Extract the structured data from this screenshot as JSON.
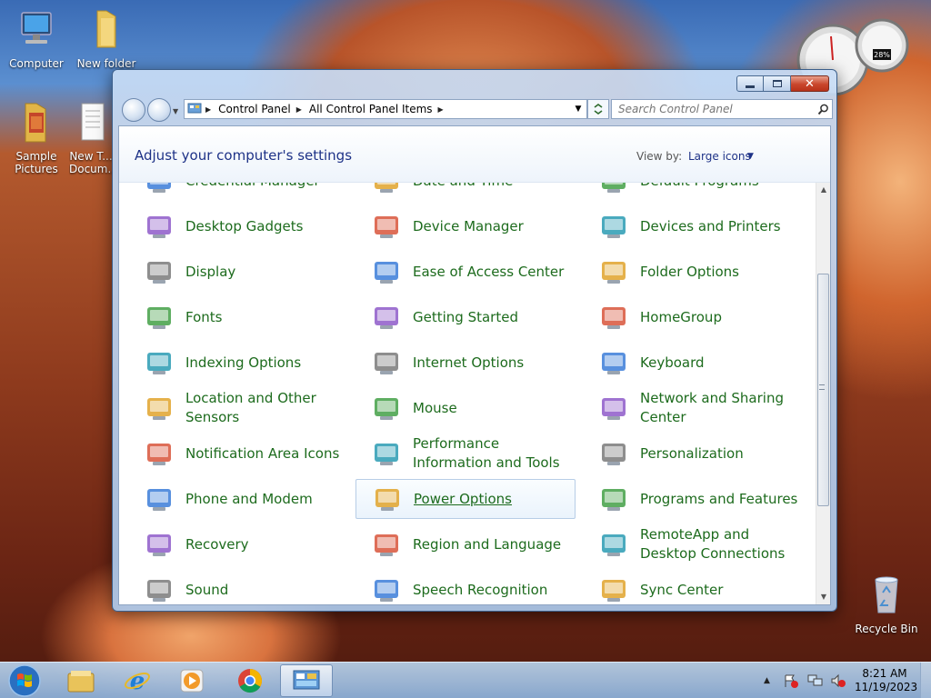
{
  "desktop": {
    "icons": [
      {
        "label": "Computer"
      },
      {
        "label": "New folder"
      },
      {
        "label": "Sample Pictures"
      },
      {
        "label": "New T... Docum..."
      },
      {
        "label": "Recycle Bin"
      }
    ],
    "gadget_cpu": "28%"
  },
  "window": {
    "address": {
      "crumbs": [
        "Control Panel",
        "All Control Panel Items"
      ]
    },
    "search": {
      "placeholder": "Search Control Panel"
    },
    "heading": "Adjust your computer's settings",
    "view_by": {
      "label": "View by:",
      "value": "Large icons"
    },
    "items": [
      {
        "label": "Credential Manager",
        "icon": "credential-manager-icon"
      },
      {
        "label": "Date and Time",
        "icon": "date-time-icon"
      },
      {
        "label": "Default Programs",
        "icon": "default-programs-icon"
      },
      {
        "label": "Desktop Gadgets",
        "icon": "desktop-gadgets-icon"
      },
      {
        "label": "Device Manager",
        "icon": "device-manager-icon"
      },
      {
        "label": "Devices and Printers",
        "icon": "printer-icon"
      },
      {
        "label": "Display",
        "icon": "display-icon"
      },
      {
        "label": "Ease of Access Center",
        "icon": "ease-of-access-icon"
      },
      {
        "label": "Folder Options",
        "icon": "folder-options-icon"
      },
      {
        "label": "Fonts",
        "icon": "fonts-icon"
      },
      {
        "label": "Getting Started",
        "icon": "getting-started-icon"
      },
      {
        "label": "HomeGroup",
        "icon": "homegroup-icon"
      },
      {
        "label": "Indexing Options",
        "icon": "indexing-icon"
      },
      {
        "label": "Internet Options",
        "icon": "internet-options-icon"
      },
      {
        "label": "Keyboard",
        "icon": "keyboard-icon"
      },
      {
        "label": "Location and Other Sensors",
        "icon": "location-sensors-icon"
      },
      {
        "label": "Mouse",
        "icon": "mouse-icon"
      },
      {
        "label": "Network and Sharing Center",
        "icon": "network-icon"
      },
      {
        "label": "Notification Area Icons",
        "icon": "notification-icon"
      },
      {
        "label": "Performance Information and Tools",
        "icon": "performance-icon"
      },
      {
        "label": "Personalization",
        "icon": "personalization-icon"
      },
      {
        "label": "Phone and Modem",
        "icon": "phone-icon"
      },
      {
        "label": "Power Options",
        "icon": "power-options-icon"
      },
      {
        "label": "Programs and Features",
        "icon": "programs-icon"
      },
      {
        "label": "Recovery",
        "icon": "recovery-icon"
      },
      {
        "label": "Region and Language",
        "icon": "region-icon"
      },
      {
        "label": "RemoteApp and Desktop Connections",
        "icon": "remoteapp-icon"
      },
      {
        "label": "Sound",
        "icon": "sound-icon"
      },
      {
        "label": "Speech Recognition",
        "icon": "microphone-icon"
      },
      {
        "label": "Sync Center",
        "icon": "sync-icon"
      }
    ],
    "hovered_item": "Power Options"
  },
  "taskbar": {
    "clock_time": "8:21 AM",
    "clock_date": "11/19/2023"
  },
  "colors": {
    "link_green": "#1d6b1d",
    "heading_blue": "#1e3287"
  }
}
